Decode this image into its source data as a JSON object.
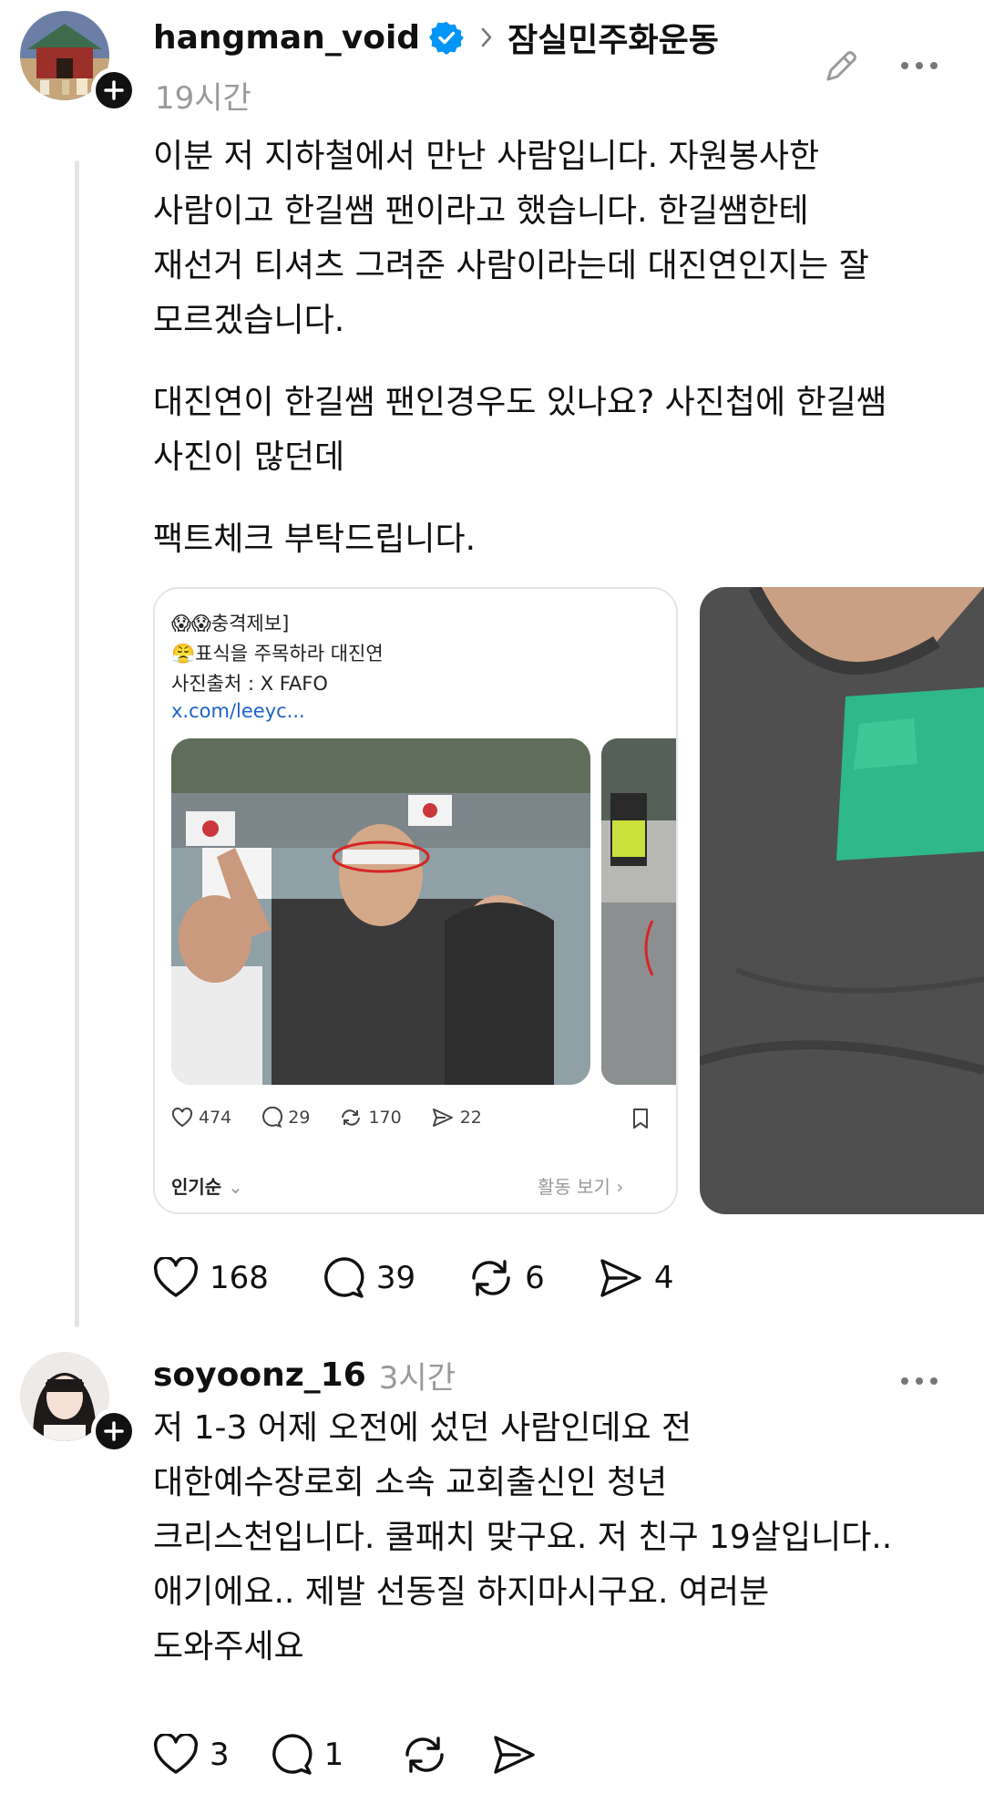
{
  "post1": {
    "username": "hangman_void",
    "topic": "잠실민주화운동",
    "time": "19시간",
    "body": [
      "이분 저 지하철에서 만난 사람입니다. 자원봉사한",
      "사람이고 한길쌤 팬이라고 했습니다. 한길쌤한테",
      "재선거 티셔츠 그려준 사람이라는데 대진연인지는 잘",
      "모르겠습니다.",
      "대진연이 한길쌤 팬인경우도 있나요? 사진첩에 한길쌤",
      "사진이 많던데",
      "팩트체크 부탁드립니다."
    ],
    "likes": "168",
    "replies": "39",
    "reposts": "6",
    "shares": "4",
    "embedded": {
      "lines": [
        "😱😱충격제보]",
        "😤표식을 주목하라 대진연",
        "사진출처 : X FAFO"
      ],
      "link": "x.com/leeyc...",
      "likes": "474",
      "replies": "29",
      "reposts": "170",
      "shares": "22",
      "sort_label": "인기순",
      "activity_label": "활동 보기"
    }
  },
  "post2": {
    "username": "soyoonz_16",
    "time": "3시간",
    "body": [
      "저 1-3 어제 오전에 섰던 사람인데요 전",
      "대한예수장로회 소속 교회출신인 청년",
      "크리스천입니다. 쿨패치 맞구요. 저 친구 19살입니다..",
      "애기에요.. 제발 선동질 하지마시구요. 여러분",
      "도와주세요"
    ],
    "likes": "3",
    "replies": "1"
  },
  "colors": {
    "verified": "#0095f6",
    "muted": "#9a9a9a",
    "line": "#e4e4e4"
  }
}
